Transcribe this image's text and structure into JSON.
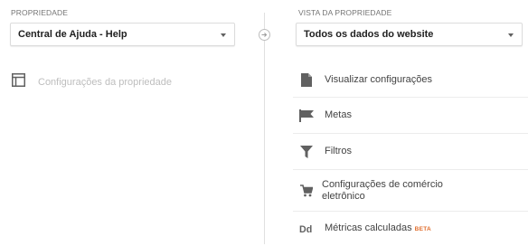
{
  "property": {
    "label": "PROPRIEDADE",
    "selected": "Central de Ajuda - Help",
    "settings_label": "Configurações da propriedade"
  },
  "view": {
    "label": "VISTA DA PROPRIEDADE",
    "selected": "Todos os dados do website"
  },
  "view_menu": [
    {
      "label": "Visualizar configurações",
      "icon": "document-icon"
    },
    {
      "label": "Metas",
      "icon": "flag-icon"
    },
    {
      "label": "Filtros",
      "icon": "filter-icon"
    },
    {
      "label": "Configurações de comércio",
      "label2": "eletrônico",
      "icon": "cart-icon"
    },
    {
      "label": "Métricas calculadas",
      "badge": "BETA",
      "icon": "dd-icon"
    }
  ],
  "colors": {
    "badge": "#e06c2b",
    "disabled_text": "#bdbdbd"
  }
}
